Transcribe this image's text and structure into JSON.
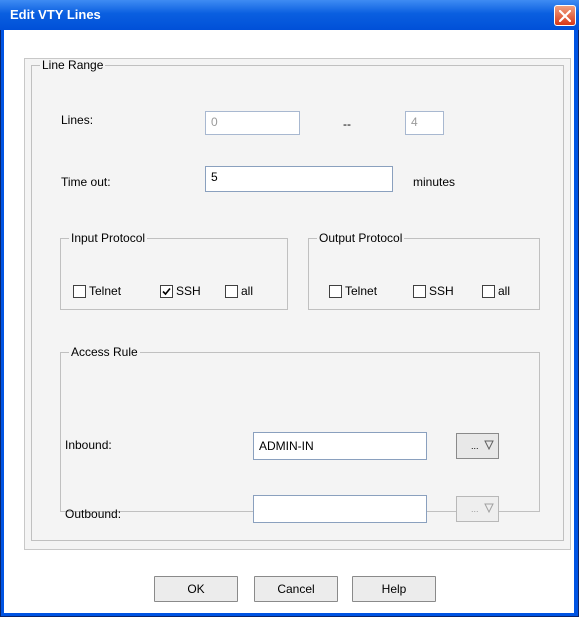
{
  "window": {
    "title": "Edit VTY Lines"
  },
  "line_range": {
    "legend": "Line Range",
    "lines_label": "Lines:",
    "lines_from": "0",
    "lines_separator": "--",
    "lines_to": "4",
    "timeout_label": "Time out:",
    "timeout_value": "5",
    "timeout_unit": "minutes"
  },
  "input_protocol": {
    "legend": "Input Protocol",
    "options": [
      {
        "label": "Telnet",
        "checked": false
      },
      {
        "label": "SSH",
        "checked": true
      },
      {
        "label": "all",
        "checked": false
      }
    ]
  },
  "output_protocol": {
    "legend": "Output Protocol",
    "options": [
      {
        "label": "Telnet",
        "checked": false
      },
      {
        "label": "SSH",
        "checked": false
      },
      {
        "label": "all",
        "checked": false
      }
    ]
  },
  "access_rule": {
    "legend": "Access Rule",
    "inbound_label": "Inbound:",
    "inbound_value": "ADMIN-IN",
    "outbound_label": "Outbound:",
    "outbound_value": "",
    "picker_label": "..."
  },
  "buttons": {
    "ok": "OK",
    "cancel": "Cancel",
    "help": "Help"
  }
}
